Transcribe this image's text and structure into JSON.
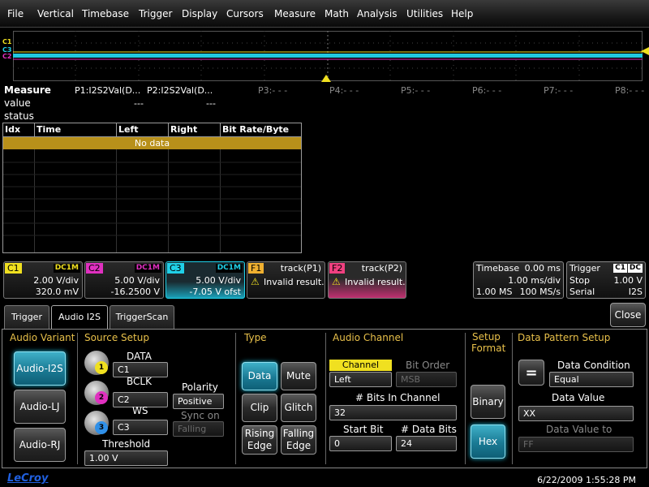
{
  "menu": [
    "File",
    "Vertical",
    "Timebase",
    "Trigger",
    "Display",
    "Cursors",
    "Measure",
    "Math",
    "Analysis",
    "Utilities",
    "Help"
  ],
  "waveform": {
    "markers": [
      "C1",
      "C2",
      "C3"
    ],
    "colors": {
      "c1": "#f0e020",
      "c2": "#e030c0",
      "c3": "#20d0e8",
      "trigger": "#f0e020"
    }
  },
  "measure": {
    "title": "Measure",
    "p1": "P1:I2S2Val(D...",
    "p2": "P2:I2S2Val(D...",
    "p3": "P3:- - -",
    "p4": "P4:- - -",
    "p5": "P5:- - -",
    "p6": "P6:- - -",
    "p7": "P7:- - -",
    "p8": "P8:- - -",
    "value_label": "value",
    "status_label": "status",
    "p1_value": "---",
    "p2_value": "---"
  },
  "table": {
    "columns": [
      "Idx",
      "Time",
      "Left",
      "Right",
      "Bit Rate/Byte"
    ],
    "empty_text": "No data"
  },
  "channels": {
    "c1": {
      "tag": "C1",
      "coupling": "DC1M",
      "vdiv": "2.00 V/div",
      "offset": "320.0 mV",
      "color": "#f0e020"
    },
    "c2": {
      "tag": "C2",
      "coupling": "DC1M",
      "vdiv": "5.00 V/div",
      "offset": "-16.2500 V",
      "color": "#e030c0"
    },
    "c3": {
      "tag": "C3",
      "coupling": "DC1M",
      "vdiv": "5.00 V/div",
      "offset": "-7.05 V ofst",
      "color": "#20d0e8"
    },
    "f1": {
      "tag": "F1",
      "func": "track(P1)",
      "msg": "Invalid result.",
      "color": "#f0b030"
    },
    "f2": {
      "tag": "F2",
      "func": "track(P2)",
      "msg": "Invalid result.",
      "color": "#f04080"
    }
  },
  "timebase": {
    "label": "Timebase",
    "delay": "0.00 ms",
    "tdiv": "1.00 ms/div",
    "samples": "1.00 MS",
    "rate": "100 MS/s"
  },
  "trigger": {
    "label": "Trigger",
    "src": "C1",
    "coupling": "DC",
    "mode": "Stop",
    "level": "1.00 V",
    "type": "Serial",
    "protocol": "I2S"
  },
  "tabs": [
    "Trigger",
    "Audio I2S",
    "TriggerScan"
  ],
  "close_label": "Close",
  "panel": {
    "audio_variant": {
      "title": "Audio Variant",
      "options": [
        "Audio-I2S",
        "Audio-LJ",
        "Audio-RJ"
      ]
    },
    "source_setup": {
      "title": "Source Setup",
      "data_label": "DATA",
      "data_value": "C1",
      "data_knob": "1",
      "bclk_label": "BCLK",
      "bclk_value": "C2",
      "bclk_knob": "2",
      "ws_label": "WS",
      "ws_value": "C3",
      "ws_knob": "3",
      "polarity_label": "Polarity",
      "polarity_value": "Positive",
      "syncon_label": "Sync on",
      "syncon_value": "Falling",
      "threshold_label": "Threshold",
      "threshold_value": "1.00 V"
    },
    "type": {
      "title": "Type",
      "data": "Data",
      "mute": "Mute",
      "clip": "Clip",
      "glitch": "Glitch",
      "rising": "Rising\nEdge",
      "falling": "Falling\nEdge"
    },
    "audio_channel": {
      "title": "Audio Channel",
      "channel_label": "Channel",
      "channel_value": "Left",
      "bitorder_label": "Bit Order",
      "bitorder_value": "MSB",
      "bits_label": "# Bits In Channel",
      "bits_value": "32",
      "startbit_label": "Start Bit",
      "startbit_value": "0",
      "databits_label": "# Data Bits",
      "databits_value": "24"
    },
    "setup_format": {
      "title_line1": "Setup",
      "title_line2": "Format",
      "binary": "Binary",
      "hex": "Hex"
    },
    "data_pattern": {
      "title": "Data Pattern Setup",
      "condition_label": "Data Condition",
      "condition_value": "Equal",
      "condition_icon": "=",
      "value_label": "Data Value",
      "value_value": "XX",
      "value_to_label": "Data Value to",
      "value_to_value": "FF"
    }
  },
  "status": {
    "brand": "LeCroy",
    "datetime": "6/22/2009 1:55:28 PM"
  }
}
